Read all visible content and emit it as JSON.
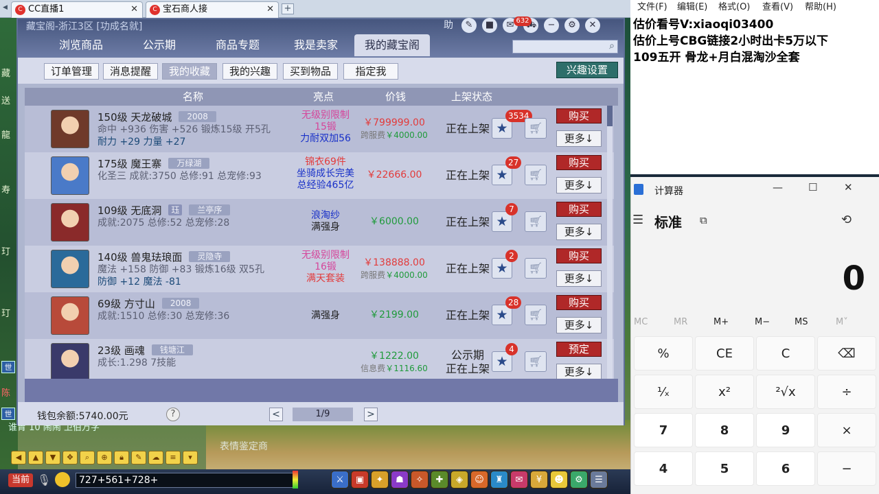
{
  "browser": {
    "tabs": [
      {
        "label": "CC直播1",
        "close": "✕"
      },
      {
        "label": "宝石商人接",
        "close": "✕"
      }
    ],
    "new_tab": "+"
  },
  "game": {
    "left_chars": [
      "藏",
      "送",
      "龍",
      "寿",
      "玎",
      "玎",
      "世",
      "陈",
      "世"
    ],
    "chat_text": "谁胃 10      闹闹   卫伯万字",
    "scene_text": "表情鉴定商",
    "bottom": {
      "current_label": "当前",
      "chat_input": "727+561+728+"
    }
  },
  "window": {
    "title": "藏宝阁-浙江3区 [功成名就]",
    "tabs": [
      "浏览商品",
      "公示期",
      "商品专题",
      "我是卖家",
      "我的藏宝阁"
    ],
    "active_tab": "我的藏宝阁",
    "top_badge": "632",
    "subtabs": [
      "订单管理",
      "消息提醒",
      "我的收藏",
      "我的兴趣",
      "买到物品",
      "指定我"
    ],
    "active_subtab": "我的收藏",
    "interest_settings": "兴趣设置",
    "columns": {
      "name": "名称",
      "highlight": "亮点",
      "price": "价钱",
      "status": "上架状态"
    },
    "rows": [
      {
        "line1": "150级  天龙破城",
        "server": "2008",
        "line2": "命中 +936  伤害 +526  锻炼15级  开5孔",
        "line3": "耐力 +29  力量 +27",
        "highlights": [
          {
            "text": "无级别限制",
            "color": "#d5459a"
          },
          {
            "text": "15锻",
            "color": "#d5459a"
          },
          {
            "text": "力耐双加56",
            "color": "#1830c8"
          }
        ],
        "price": "￥799999.00",
        "fee_label": "跨服费",
        "fee": "￥4000.00",
        "status": [
          "正在上架"
        ],
        "count": "3534",
        "buy": "购买",
        "more": "更多↓",
        "avatar_color": "#6f3a2a"
      },
      {
        "line1": "175级  魔王寨",
        "server": "万绿湖",
        "line2": "化圣三  成就:3750  总修:91  总宠修:93",
        "line3": "",
        "highlights": [
          {
            "text": "锦衣69件",
            "color": "#e23b3b"
          },
          {
            "text": "坐骑成长完美",
            "color": "#1830c8"
          },
          {
            "text": "总经验465亿",
            "color": "#1830c8"
          }
        ],
        "price": "￥22666.00",
        "fee_label": "",
        "fee": "",
        "status": [
          "正在上架"
        ],
        "count": "27",
        "buy": "购买",
        "more": "更多↓",
        "avatar_color": "#4a7ac8"
      },
      {
        "line1": "109级  无底洞",
        "badge": "珏",
        "server": "兰亭序",
        "line2": "成就:2075  总修:52  总宠修:28",
        "line3": "",
        "highlights": [
          {
            "text": "浪淘纱",
            "color": "#1830c8"
          },
          {
            "text": "满强身",
            "color": "#222222"
          }
        ],
        "price": "￥6000.00",
        "fee_label": "",
        "fee": "",
        "status": [
          "正在上架"
        ],
        "count": "7",
        "buy": "购买",
        "more": "更多↓",
        "avatar_color": "#8a2a2a"
      },
      {
        "line1": "140级  兽鬼珐琅面",
        "server": "灵隐寺",
        "line2": "魔法 +158  防御 +83  锻炼16级  双5孔",
        "line3": "防御 +12  魔法 -81",
        "highlights": [
          {
            "text": "无级别限制",
            "color": "#d5459a"
          },
          {
            "text": "16锻",
            "color": "#d5459a"
          },
          {
            "text": "满天套装",
            "color": "#e23b3b"
          }
        ],
        "price": "￥138888.00",
        "fee_label": "跨服费",
        "fee": "￥4000.00",
        "status": [
          "正在上架"
        ],
        "count": "2",
        "buy": "购买",
        "more": "更多↓",
        "avatar_color": "#2a6a9a"
      },
      {
        "line1": "69级  方寸山",
        "server": "2008",
        "line2": "成就:1510  总修:30  总宠修:36",
        "line3": "",
        "highlights": [
          {
            "text": "满强身",
            "color": "#222222"
          }
        ],
        "price": "￥2199.00",
        "fee_label": "",
        "fee": "",
        "status": [
          "正在上架"
        ],
        "count": "28",
        "buy": "购买",
        "more": "更多↓",
        "avatar_color": "#b84a3a"
      },
      {
        "line1": "23级  画魂",
        "server": "钱塘江",
        "line2": "成长:1.298  7技能",
        "line3": "",
        "highlights": [],
        "price": "￥1222.00",
        "fee_label": "信息费",
        "fee": "￥1116.60",
        "status": [
          "公示期",
          "正在上架"
        ],
        "count": "4",
        "buy": "预定",
        "more": "更多↓",
        "avatar_color": "#3a3a6a"
      }
    ],
    "footer": {
      "wallet_label": "钱包余额:",
      "wallet_value": "5740.00元",
      "help": "?",
      "prev": "<",
      "page": "1/9",
      "next": ">"
    }
  },
  "notepad": {
    "menu": [
      "文件(F)",
      "编辑(E)",
      "格式(O)",
      "查看(V)",
      "帮助(H)"
    ],
    "lines": [
      "估价看号V:xiaoqi03400",
      "估价上号CBG链接2小时出卡5万以下",
      "109五开 骨龙+月白混淘沙全套"
    ]
  },
  "calculator": {
    "title": "计算器",
    "mode": "标准",
    "display": "0",
    "memory": [
      "MC",
      "MR",
      "M+",
      "M−",
      "MS",
      "M˅"
    ],
    "keys": [
      [
        "%",
        "CE",
        "C",
        "⌫"
      ],
      [
        "¹⁄ₓ",
        "x²",
        "²√x",
        "÷"
      ],
      [
        "7",
        "8",
        "9",
        "×"
      ],
      [
        "4",
        "5",
        "6",
        "−"
      ]
    ]
  }
}
